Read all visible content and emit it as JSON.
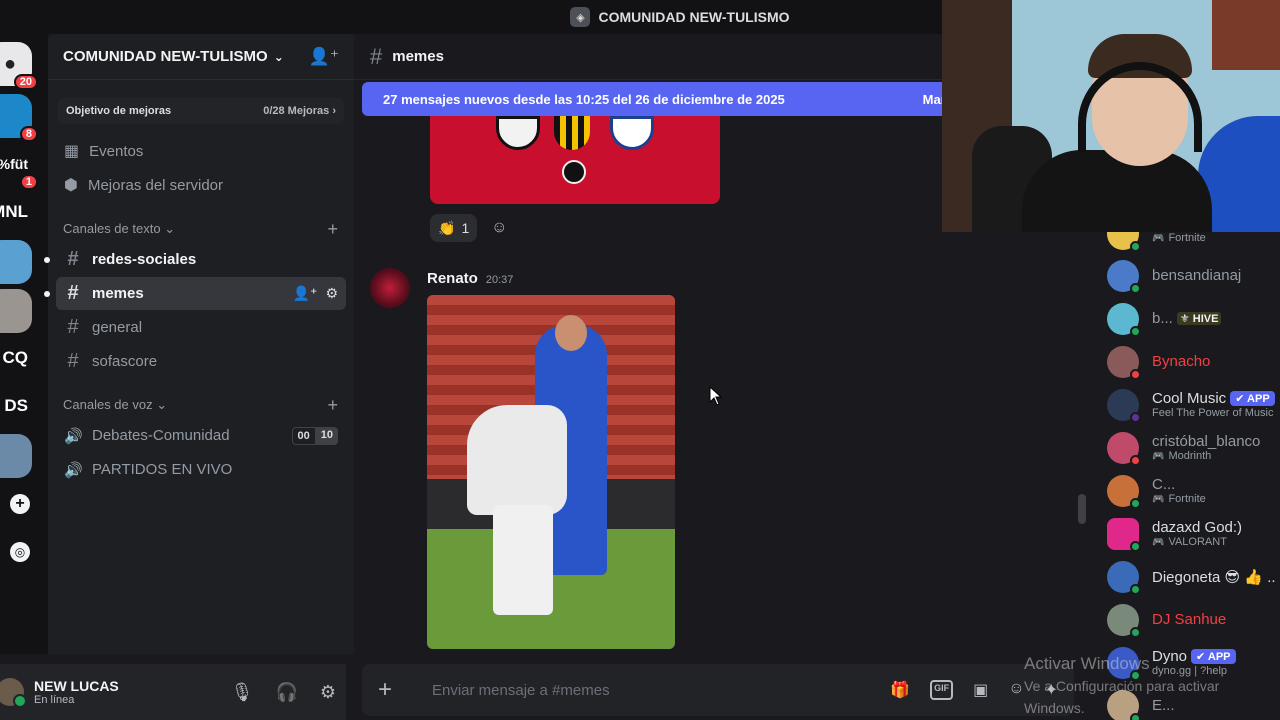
{
  "window": {
    "title": "COMUNIDAD NEW-TULISMO"
  },
  "servers": [
    {
      "label": "",
      "badge": "20",
      "color": "#e8e8ea"
    },
    {
      "label": "",
      "badge": "8",
      "color": "#1c87c9"
    },
    {
      "label": "%füt",
      "badge": "1",
      "color": ""
    },
    {
      "label": "MNL",
      "badge": "",
      "color": ""
    },
    {
      "label": "",
      "badge": "",
      "color": "#5aa0d0"
    },
    {
      "label": "",
      "badge": "",
      "color": "#9a9590"
    },
    {
      "label": "CQ",
      "badge": "",
      "color": ""
    },
    {
      "label": "DS",
      "badge": "",
      "color": ""
    },
    {
      "label": "",
      "badge": "",
      "color": "#6a8aa8"
    }
  ],
  "sidebar": {
    "guild_name": "COMUNIDAD NEW-TULISMO",
    "boost": {
      "label": "Objetivo de mejoras",
      "progress": "0/28 Mejoras"
    },
    "events": "Eventos",
    "boosts": "Mejoras del servidor",
    "text_category": "Canales de texto",
    "text_channels": [
      {
        "name": "redes-sociales",
        "state": "unread"
      },
      {
        "name": "memes",
        "state": "active"
      },
      {
        "name": "general",
        "state": "normal"
      },
      {
        "name": "sofascore",
        "state": "normal"
      }
    ],
    "voice_category": "Canales de voz",
    "voice_channels": [
      {
        "name": "Debates-Comunidad",
        "count_a": "00",
        "count_b": "10"
      },
      {
        "name": "PARTIDOS EN VIVO"
      }
    ]
  },
  "user": {
    "name": "NEW LUCAS",
    "status": "En línea"
  },
  "chat": {
    "channel": "memes",
    "new_messages": "27 mensajes nuevos desde las 10:25 del 26 de diciembre de 2025",
    "mark_read": "Marc",
    "reaction": {
      "emoji": "👏",
      "count": "1"
    },
    "message": {
      "author": "Renato",
      "time": "20:37"
    },
    "composer_placeholder": "Enviar mensaje a #memes"
  },
  "members": [
    {
      "name": "",
      "activity": "Fortnite",
      "status": "on",
      "avatar": "#e8c04a",
      "color": "#949ba4"
    },
    {
      "name": "bensandianaj",
      "activity": "",
      "status": "on",
      "avatar": "#4a7ac8",
      "color": "#949ba4"
    },
    {
      "name": "b...",
      "tag": "HIVE",
      "activity": "",
      "status": "on",
      "avatar": "#5bb8d0",
      "color": "#949ba4"
    },
    {
      "name": "Bynacho",
      "activity": "",
      "status": "dnd",
      "avatar": "#8a5a5a",
      "color": "#f23f43"
    },
    {
      "name": "Cool Music",
      "tag_app": "✔ APP",
      "activity": "Feel The Power of Music",
      "status": "str",
      "avatar": "#2b3a55",
      "color": "#dbdee1"
    },
    {
      "name": "cristóbal_blanco",
      "activity": "Modrinth",
      "status": "dnd",
      "avatar": "#c04a6a",
      "color": "#949ba4"
    },
    {
      "name": "C...",
      "activity": "Fortnite",
      "status": "on",
      "avatar": "#c8703a",
      "color": "#949ba4"
    },
    {
      "name": "dazaxd God:)",
      "activity": "VALORANT",
      "status": "on",
      "avatar": "#e0288a",
      "color": "#dbdee1"
    },
    {
      "name": "Diegoneta 😎 👍 ..",
      "activity": "",
      "status": "on",
      "avatar": "#3a6ab8",
      "color": "#dbdee1"
    },
    {
      "name": "DJ Sanhue",
      "activity": "",
      "status": "on",
      "avatar": "#7a8a7a",
      "color": "#f23f43"
    },
    {
      "name": "Dyno",
      "tag_app": "✔ APP",
      "activity": "dyno.gg | ?help",
      "status": "on",
      "avatar": "#3a5ac8",
      "color": "#dbdee1"
    },
    {
      "name": "E...",
      "activity": "",
      "status": "on",
      "avatar": "#b8a080",
      "color": "#949ba4"
    }
  ],
  "watermark": {
    "line1": "Activar Windows",
    "line2": "Ve a Configuración para activar Windows."
  }
}
